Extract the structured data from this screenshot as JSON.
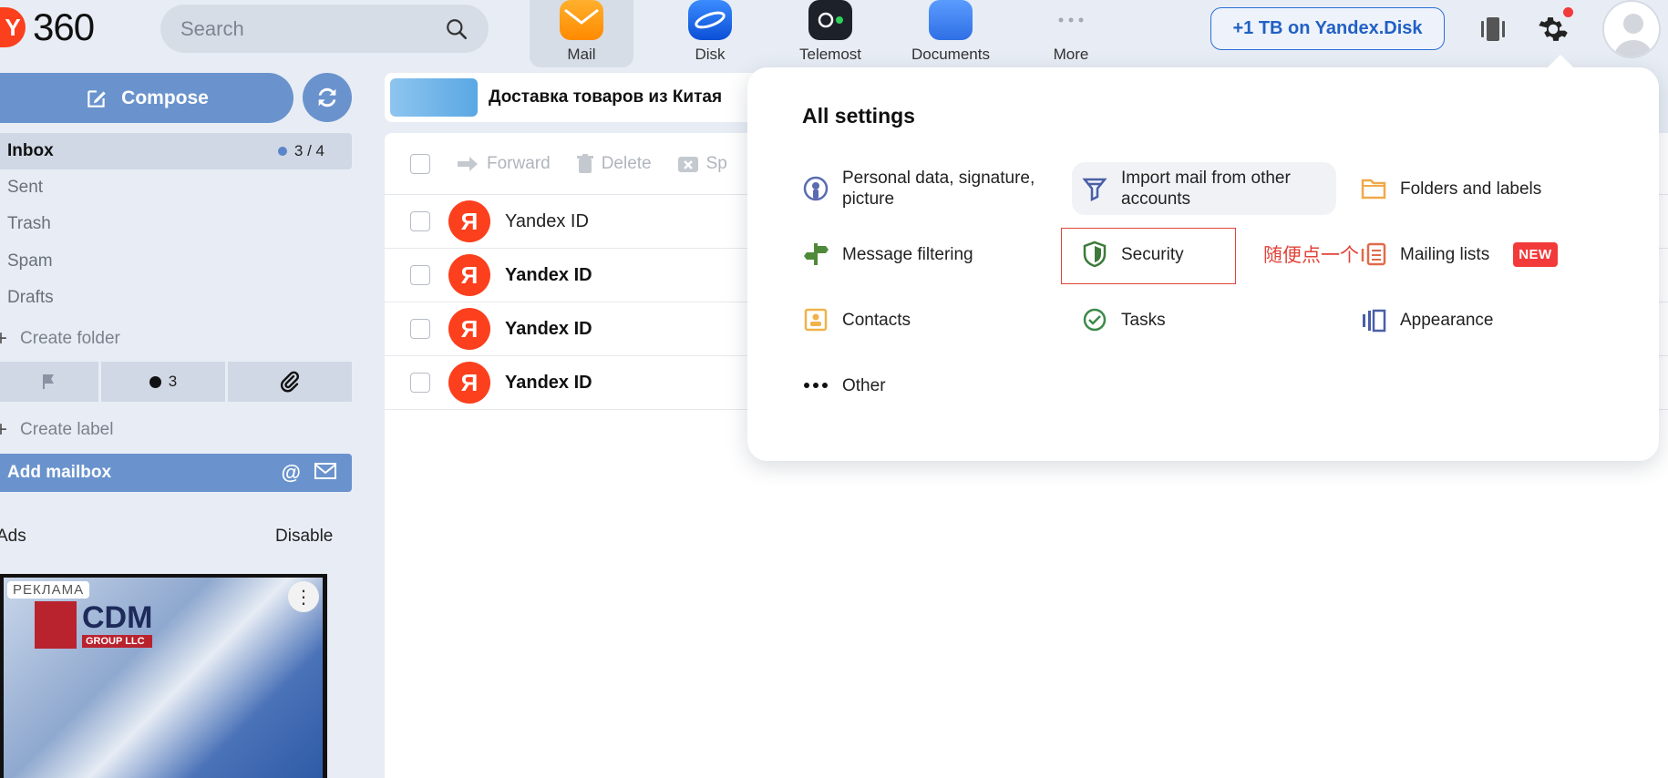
{
  "logo": {
    "text": "360"
  },
  "search": {
    "placeholder": "Search"
  },
  "apps": [
    {
      "label": "Mail",
      "active": true
    },
    {
      "label": "Disk"
    },
    {
      "label": "Telemost"
    },
    {
      "label": "Documents"
    },
    {
      "label": "More"
    }
  ],
  "header": {
    "disk_button": "+1 TB on Yandex.Disk"
  },
  "sidebar": {
    "compose": "Compose",
    "folders": [
      {
        "label": "Inbox",
        "count": "3 / 4"
      },
      {
        "label": "Sent"
      },
      {
        "label": "Trash"
      },
      {
        "label": "Spam"
      },
      {
        "label": "Drafts"
      }
    ],
    "create_folder": "Create folder",
    "labels_unread_count": "3",
    "create_label": "Create label",
    "add_mailbox": "Add mailbox",
    "ads_label": "Ads",
    "disable": "Disable",
    "ad": {
      "tag": "РЕКЛАМА",
      "brand": "CDM",
      "brand_sub": "GROUP LLC"
    }
  },
  "banner": {
    "text": "Доставка товаров из Китая"
  },
  "toolbar": {
    "forward": "Forward",
    "delete": "Delete",
    "spam": "Sp"
  },
  "messages": [
    {
      "from": "Yandex ID",
      "avatar": "Я",
      "unread": false
    },
    {
      "from": "Yandex ID",
      "avatar": "Я",
      "unread": true
    },
    {
      "from": "Yandex ID",
      "avatar": "Я",
      "unread": true
    },
    {
      "from": "Yandex ID",
      "avatar": "Я",
      "unread": true
    }
  ],
  "settings": {
    "title": "All settings",
    "items": [
      {
        "label": "Personal data, signature,\npicture"
      },
      {
        "label": "Import mail from other\naccounts"
      },
      {
        "label": "Folders and labels"
      },
      {
        "label": "Message filtering"
      },
      {
        "label": "Security"
      },
      {
        "label": "Mailing lists",
        "badge": "NEW"
      },
      {
        "label": "Contacts"
      },
      {
        "label": "Tasks"
      },
      {
        "label": "Appearance"
      },
      {
        "label": "Other"
      }
    ],
    "annotation": "随便点一个"
  },
  "colors": {
    "accent": "#6a93cd",
    "yandex_red": "#fc3f1d",
    "highlight_red": "#e0443a"
  }
}
